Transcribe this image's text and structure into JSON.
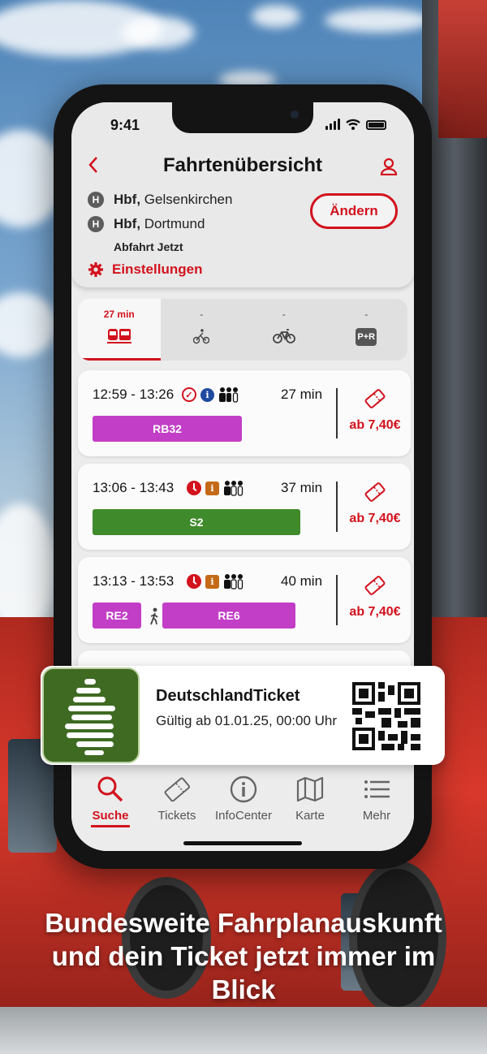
{
  "status_bar": {
    "time": "9:41"
  },
  "header": {
    "title": "Fahrtenübersicht",
    "from_station": "Hbf,",
    "from_city": "Gelsenkirchen",
    "to_station": "Hbf,",
    "to_city": "Dortmund",
    "departure": "Abfahrt Jetzt",
    "change_button": "Ändern",
    "settings_label": "Einstellungen",
    "stop_badge": "H"
  },
  "modes": [
    {
      "duration": "27 min",
      "icon": "train-bus-icon",
      "active": true
    },
    {
      "duration": "-",
      "icon": "walking-bike-icon",
      "active": false
    },
    {
      "duration": "-",
      "icon": "bicycle-icon",
      "active": false
    },
    {
      "duration": "-",
      "icon": "park-ride-icon",
      "label": "P+R",
      "active": false
    }
  ],
  "trips": [
    {
      "time": "12:59 - 13:26",
      "duration": "27 min",
      "price": "ab 7,40€",
      "status": "on-time",
      "info": "blue",
      "lines": [
        {
          "name": "RB32",
          "color": "#c23ec6"
        }
      ]
    },
    {
      "time": "13:06 - 13:43",
      "duration": "37 min",
      "price": "ab 7,40€",
      "status": "delayed",
      "info": "orange",
      "lines": [
        {
          "name": "S2",
          "color": "#3f8a2a"
        }
      ]
    },
    {
      "time": "13:13 - 13:53",
      "duration": "40 min",
      "price": "ab 7,40€",
      "status": "delayed",
      "info": "orange",
      "lines": [
        {
          "name": "RE2",
          "color": "#c23ec6"
        },
        {
          "name": "RE6",
          "color": "#c23ec6"
        }
      ]
    }
  ],
  "info_symbol": "i",
  "deutschland_ticket": {
    "name": "DeutschlandTicket",
    "validity": "Gültig ab 01.01.25, 00:00 Uhr"
  },
  "tabbar": [
    {
      "label": "Suche",
      "icon": "search-icon",
      "active": true
    },
    {
      "label": "Tickets",
      "icon": "ticket-icon",
      "active": false
    },
    {
      "label": "InfoCenter",
      "icon": "info-icon",
      "active": false
    },
    {
      "label": "Karte",
      "icon": "map-icon",
      "active": false
    },
    {
      "label": "Mehr",
      "icon": "menu-icon",
      "active": false
    }
  ],
  "headline": "Bundesweite Fahrplan­auskunft und dein Ticket jetzt immer im Blick",
  "colors": {
    "accent": "#d2121d",
    "regional": "#c23ec6",
    "sbahn": "#3f8a2a",
    "dticket_green": "#3e6a22"
  }
}
